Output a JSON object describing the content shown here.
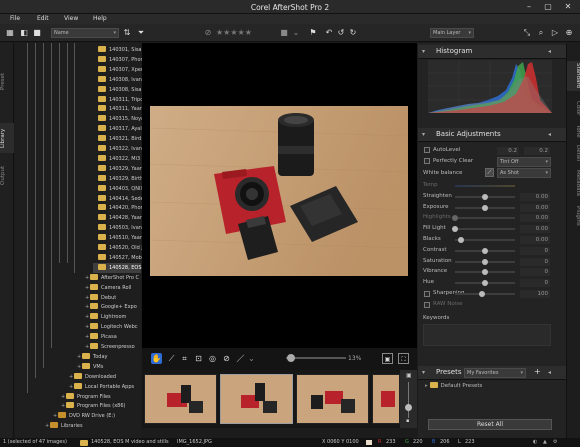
{
  "app": {
    "title": "Corel AfterShot Pro 2"
  },
  "menu": [
    "File",
    "Edit",
    "View",
    "Help"
  ],
  "toolbar": {
    "sort_label": "Name",
    "layer_label": "Main Layer"
  },
  "left_tabs": [
    "Output",
    "Library",
    "Preset"
  ],
  "tree": [
    {
      "label": "140301, Sisa W",
      "indent": 4,
      "folder": true
    },
    {
      "label": "140307, Phone",
      "indent": 4,
      "folder": true
    },
    {
      "label": "140307, Xperia",
      "indent": 4,
      "folder": true
    },
    {
      "label": "140308, Ivan",
      "indent": 4,
      "folder": true
    },
    {
      "label": "140308, Sisa ar",
      "indent": 4,
      "folder": true
    },
    {
      "label": "140311, Tripod",
      "indent": 4,
      "folder": true
    },
    {
      "label": "140311, Yaara F",
      "indent": 4,
      "folder": true
    },
    {
      "label": "140315, Noya a",
      "indent": 4,
      "folder": true
    },
    {
      "label": "140317, Ayalon",
      "indent": 4,
      "folder": true
    },
    {
      "label": "140321, Bird W",
      "indent": 4,
      "folder": true
    },
    {
      "label": "140322, Ivan",
      "indent": 4,
      "folder": true
    },
    {
      "label": "140322, Mi3 Re",
      "indent": 4,
      "folder": true
    },
    {
      "label": "140329, Yaara F",
      "indent": 4,
      "folder": true
    },
    {
      "label": "140329, Birthd",
      "indent": 4,
      "folder": true
    },
    {
      "label": "140403, QNIX n",
      "indent": 4,
      "folder": true
    },
    {
      "label": "140414, Seder",
      "indent": 4,
      "folder": true
    },
    {
      "label": "140420, Phone",
      "indent": 4,
      "folder": true
    },
    {
      "label": "140428, Yaara F",
      "indent": 4,
      "folder": true
    },
    {
      "label": "140503, Ivan",
      "indent": 4,
      "folder": true
    },
    {
      "label": "140510, Yaara F",
      "indent": 4,
      "folder": true
    },
    {
      "label": "140520, Old Jal",
      "indent": 4,
      "folder": true
    },
    {
      "label": "140527, Mobio",
      "indent": 4,
      "folder": true
    },
    {
      "label": "140528, EOS M",
      "indent": 4,
      "folder": true,
      "selected": true
    },
    {
      "label": "AfterShot Pro C",
      "indent": 3,
      "folder": true
    },
    {
      "label": "Camera Roll",
      "indent": 3,
      "folder": true
    },
    {
      "label": "Debut",
      "indent": 3,
      "folder": true
    },
    {
      "label": "Google+ Expo",
      "indent": 3,
      "folder": true
    },
    {
      "label": "Lightroom",
      "indent": 3,
      "folder": true
    },
    {
      "label": "Logitech Webc",
      "indent": 3,
      "folder": true
    },
    {
      "label": "Picasa",
      "indent": 3,
      "folder": true
    },
    {
      "label": "Screenpresso",
      "indent": 3,
      "folder": true
    },
    {
      "label": "Today",
      "indent": 2,
      "folder": true
    },
    {
      "label": "VMs",
      "indent": 2,
      "folder": true
    },
    {
      "label": "Downloaded",
      "indent": 1,
      "folder": true
    },
    {
      "label": "Local Portable Apps",
      "indent": 1,
      "folder": true
    },
    {
      "label": "Program Files",
      "indent": 0,
      "folder": true
    },
    {
      "label": "Program Files (x86)",
      "indent": 0,
      "folder": true
    },
    {
      "label": "DVD RW Drive (E:)",
      "indent": -1,
      "folder": true
    },
    {
      "label": "Libraries",
      "indent": -2,
      "folder": true
    }
  ],
  "viewer": {
    "zoom_label": "13%"
  },
  "histogram": {
    "title": "Histogram"
  },
  "basic_adjustments": {
    "title": "Basic Adjustments",
    "autolevel_label": "AutoLevel",
    "autolevel_low": "0.2",
    "autolevel_high": "0.2",
    "perfectly_clear_label": "Perfectly Clear",
    "perfectly_clear_value": "Tint Off",
    "white_balance_label": "White balance",
    "white_balance_value": "As Shot",
    "rows": [
      {
        "label": "Temp",
        "value": "",
        "dim": true,
        "pos": 0.5
      },
      {
        "label": "Straighten",
        "value": "0.00",
        "dim": false,
        "pos": 0.5
      },
      {
        "label": "Exposure",
        "value": "0.00",
        "dim": false,
        "pos": 0.5
      },
      {
        "label": "Highlights",
        "value": "0.00",
        "dim": true,
        "pos": 0.0
      },
      {
        "label": "Fill Light",
        "value": "0.00",
        "dim": false,
        "pos": 0.0
      },
      {
        "label": "Blacks",
        "value": "0.00",
        "dim": false,
        "pos": 0.1
      },
      {
        "label": "Contrast",
        "value": "0",
        "dim": false,
        "pos": 0.5
      },
      {
        "label": "Saturation",
        "value": "0",
        "dim": false,
        "pos": 0.5
      },
      {
        "label": "Vibrance",
        "value": "0",
        "dim": false,
        "pos": 0.5
      },
      {
        "label": "Hue",
        "value": "0",
        "dim": false,
        "pos": 0.5
      },
      {
        "label": "Sharpening",
        "value": "100",
        "dim": false,
        "pos": 0.45
      },
      {
        "label": "RAW Noise",
        "value": "",
        "dim": true,
        "pos": 0.5
      }
    ],
    "keywords_label": "Keywords"
  },
  "presets": {
    "title": "Presets",
    "filter_value": "My Favorites",
    "default_label": "Default Presets"
  },
  "reset_label": "Reset All",
  "right_tabs": [
    "Standard",
    "Color",
    "Tone",
    "Detail",
    "Metadata",
    "Plugins"
  ],
  "status": {
    "selection": "1 (selected of 47 images)",
    "folder": "140528, EOS M video and stills",
    "filename": "IMG_1652.JPG",
    "coords": "X 0060  Y 0100",
    "r": "233",
    "g": "220",
    "b": "206",
    "l": "223"
  },
  "colors": {
    "accent": "#d9b24b",
    "histogram_blue": "#2f6fd1",
    "histogram_green": "#3fa34a",
    "histogram_red": "#d23030"
  }
}
